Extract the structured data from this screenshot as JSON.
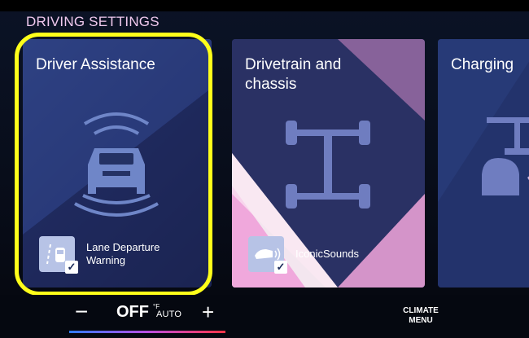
{
  "header": {
    "title": "DRIVING SETTINGS"
  },
  "cards": [
    {
      "title": "Driver Assistance",
      "icon": "car-sensor-waves-icon",
      "chip": {
        "label": "Lane Departure\nWarning",
        "icon": "lane-departure-icon",
        "checked": true
      },
      "selected": true
    },
    {
      "title": "Drivetrain and\nchassis",
      "icon": "chassis-axle-icon",
      "chip": {
        "label": "IconicSounds",
        "icon": "speaker-sound-icon",
        "checked": true
      },
      "selected": false
    },
    {
      "title": "Charging",
      "icon": "charging-plug-icon",
      "selected": false
    }
  ],
  "climate_bar": {
    "minus": "−",
    "temperature": "OFF",
    "unit": "°F",
    "mode": "AUTO",
    "plus": "+",
    "menu_label": "CLIMATE\nMENU"
  },
  "colors": {
    "highlight": "#ffff1a",
    "title": "#f0c9ee",
    "card_dark": "#1f2b5e",
    "card_pink": "#f0a8dc"
  }
}
